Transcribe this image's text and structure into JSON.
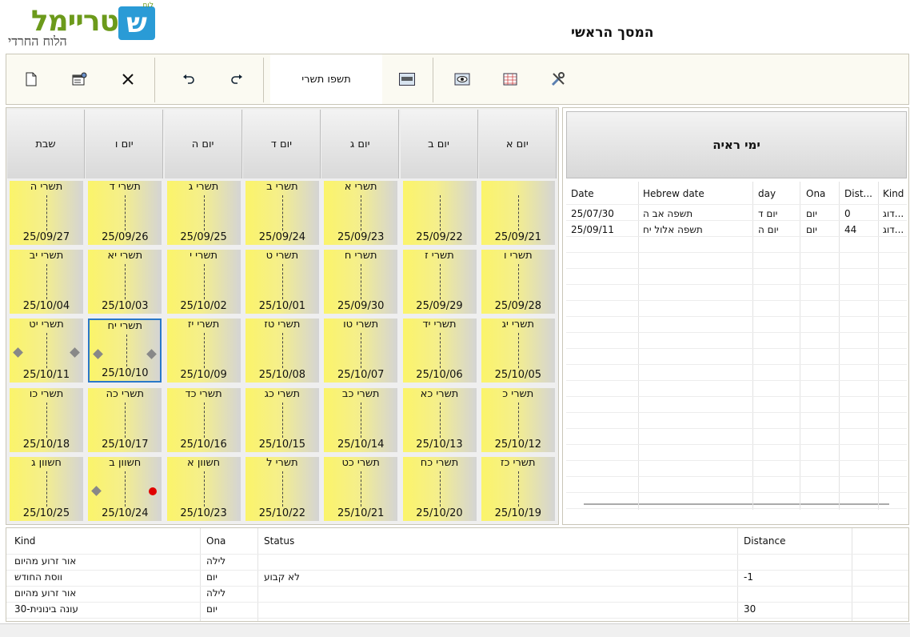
{
  "header": {
    "logo_main": "טריימל",
    "logo_letter": "ש",
    "logo_small": "לוח",
    "logo_sub": "הלוח החרדי",
    "title": "המסך הראשי"
  },
  "toolbar": {
    "month_label": "תשפו תשרי",
    "icons": [
      "new-document-icon",
      "properties-icon",
      "close-icon",
      "undo-icon",
      "redo-icon",
      "calendar-view-icon",
      "eye-view-icon",
      "calendar-grid-icon",
      "tools-icon"
    ]
  },
  "calendar": {
    "day_headers": [
      "יום א",
      "יום ב",
      "יום ג",
      "יום ד",
      "יום ה",
      "יום ו",
      "שבת"
    ],
    "weeks": [
      [
        {
          "heb": "",
          "greg": "25/09/21"
        },
        {
          "heb": "",
          "greg": "25/09/22"
        },
        {
          "heb": "תשרי א",
          "greg": "25/09/23"
        },
        {
          "heb": "תשרי ב",
          "greg": "25/09/24"
        },
        {
          "heb": "תשרי ג",
          "greg": "25/09/25"
        },
        {
          "heb": "תשרי ד",
          "greg": "25/09/26"
        },
        {
          "heb": "תשרי ה",
          "greg": "25/09/27"
        }
      ],
      [
        {
          "heb": "תשרי ו",
          "greg": "25/09/28"
        },
        {
          "heb": "תשרי ז",
          "greg": "25/09/29"
        },
        {
          "heb": "תשרי ח",
          "greg": "25/09/30"
        },
        {
          "heb": "תשרי ט",
          "greg": "25/10/01"
        },
        {
          "heb": "תשרי י",
          "greg": "25/10/02"
        },
        {
          "heb": "תשרי יא",
          "greg": "25/10/03"
        },
        {
          "heb": "תשרי יב",
          "greg": "25/10/04"
        }
      ],
      [
        {
          "heb": "תשרי יג",
          "greg": "25/10/05"
        },
        {
          "heb": "תשרי יד",
          "greg": "25/10/06"
        },
        {
          "heb": "תשרי טו",
          "greg": "25/10/07"
        },
        {
          "heb": "תשרי טז",
          "greg": "25/10/08"
        },
        {
          "heb": "תשרי יז",
          "greg": "25/10/09"
        },
        {
          "heb": "תשרי יח",
          "greg": "25/10/10",
          "selected": true,
          "dots": [
            "gray-left",
            "gray-right"
          ]
        },
        {
          "heb": "תשרי יט",
          "greg": "25/10/11",
          "dots": [
            "gray-left",
            "gray-right"
          ]
        }
      ],
      [
        {
          "heb": "תשרי כ",
          "greg": "25/10/12"
        },
        {
          "heb": "תשרי כא",
          "greg": "25/10/13"
        },
        {
          "heb": "תשרי כב",
          "greg": "25/10/14"
        },
        {
          "heb": "תשרי כג",
          "greg": "25/10/15"
        },
        {
          "heb": "תשרי כד",
          "greg": "25/10/16"
        },
        {
          "heb": "תשרי כה",
          "greg": "25/10/17"
        },
        {
          "heb": "תשרי כו",
          "greg": "25/10/18"
        }
      ],
      [
        {
          "heb": "תשרי כז",
          "greg": "25/10/19"
        },
        {
          "heb": "תשרי כח",
          "greg": "25/10/20"
        },
        {
          "heb": "תשרי כט",
          "greg": "25/10/21"
        },
        {
          "heb": "תשרי ל",
          "greg": "25/10/22"
        },
        {
          "heb": "חשוון א",
          "greg": "25/10/23"
        },
        {
          "heb": "חשוון ב",
          "greg": "25/10/24",
          "dots": [
            "gray-left",
            "red-right"
          ]
        },
        {
          "heb": "חשוון ג",
          "greg": "25/10/25"
        }
      ]
    ]
  },
  "right_panel": {
    "title": "ימי ראיה",
    "columns": [
      "Date",
      "Hebrew date",
      "day",
      "Ona",
      "Dist...",
      "Kind"
    ],
    "rows": [
      [
        "25/07/30",
        "תשפה אב ה",
        "יום ד",
        "יום",
        "0",
        "דוג..."
      ],
      [
        "25/09/11",
        "תשפה אלול יח",
        "יום ה",
        "יום",
        "44",
        "דוג..."
      ]
    ]
  },
  "bottom_grid": {
    "columns": [
      "Kind",
      "Ona",
      "Status",
      "Distance"
    ],
    "rows": [
      [
        "אור זרוע מהיום",
        "לילה",
        "",
        ""
      ],
      [
        "ווסת החודש",
        "יום",
        "לא קבוע",
        "-1"
      ],
      [
        "אור זרוע מהיום",
        "לילה",
        "",
        ""
      ],
      [
        "עונה בינונית-30",
        "יום",
        "",
        "30"
      ]
    ]
  },
  "colors": {
    "cell_yellow": "#fbf46a",
    "selected_border": "#2a78c8",
    "logo_green": "#6c9a1b",
    "logo_blue": "#2a9bd6",
    "dot_red": "#e00000"
  }
}
